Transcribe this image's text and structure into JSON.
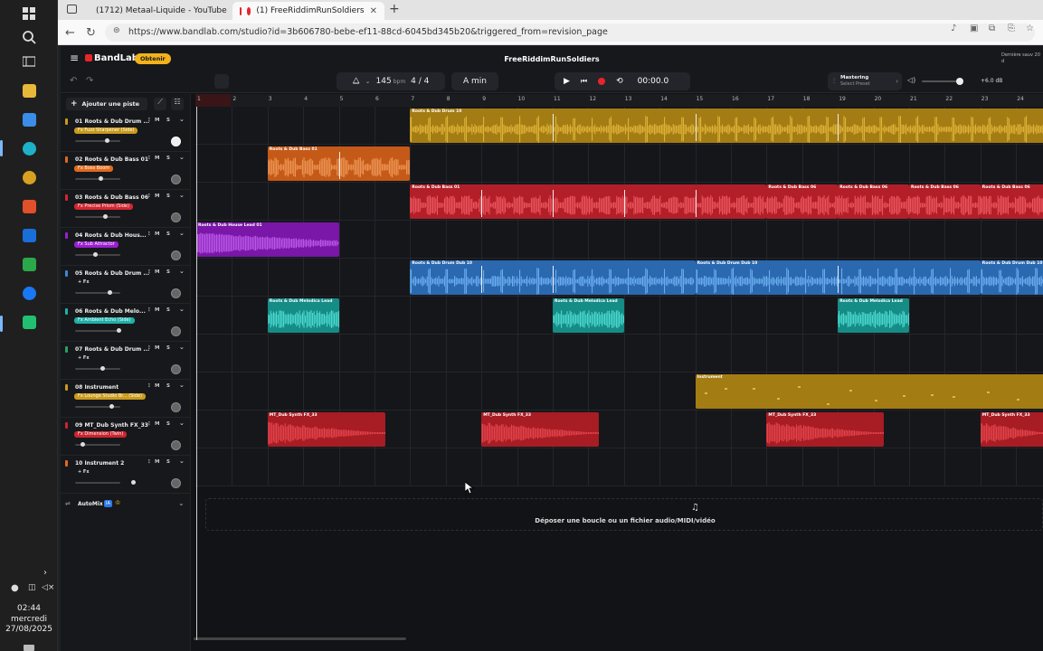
{
  "taskbar": {
    "time": "02:44",
    "day": "mercredi",
    "date": "27/08/2025"
  },
  "browser": {
    "tabs": [
      {
        "title": "(1712) Metaal-Liquide - YouTube"
      },
      {
        "title": "(1) FreeRiddimRunSoldiers"
      }
    ],
    "url": "https://www.bandlab.com/studio?id=3b606780-bebe-ef11-88cd-6045bd345b20&triggered_from=revision_page"
  },
  "app": {
    "logo": "BandLab",
    "upgrade": "Obtenir",
    "project_title": "FreeRiddimRunSoldiers",
    "last_saved": "Dernière sauv 20 d",
    "tempo": "145",
    "tempo_unit": "bpm",
    "time_sig": "4 / 4",
    "key": "A min",
    "time": "00:00.0",
    "mastering": "Mastering",
    "preset": "Select Preset",
    "master_db": "+6.0 dB",
    "add_track": "Ajouter une piste",
    "ruler": [
      "1",
      "2",
      "3",
      "4",
      "5",
      "6",
      "7",
      "8",
      "9",
      "10",
      "11",
      "12",
      "13",
      "14",
      "15",
      "16",
      "17",
      "18",
      "19",
      "20",
      "21",
      "22",
      "23",
      "24"
    ],
    "automix": "AutoMix",
    "automix_badge": "IA",
    "drop_text": "Déposer une boucle ou un fichier audio/MIDI/vidéo",
    "tracks": [
      {
        "name": "01 Roots & Dub Drum ...",
        "fx": "Fx Fuzz Sharpener (Side)",
        "color": "#c99a1c",
        "fxcolor": "#c99a1c"
      },
      {
        "name": "02 Roots & Dub Bass 01",
        "fx": "Fx Boss Boom",
        "color": "#e06a1f",
        "fxcolor": "#e06a1f"
      },
      {
        "name": "03 Roots & Dub Bass 06",
        "fx": "Fx Precise Prism (Side)",
        "color": "#d02730",
        "fxcolor": "#d02730"
      },
      {
        "name": "04 Roots & Dub Hous...",
        "fx": "Fx Sub Attractor",
        "color": "#9a1fd0",
        "fxcolor": "#9a1fd0"
      },
      {
        "name": "05 Roots & Dub Drum ...",
        "fx": "+ Fx",
        "color": "#3c86d8",
        "fxcolor": ""
      },
      {
        "name": "06 Roots & Dub Melo...",
        "fx": "Fx Ambient Echo (Side)",
        "color": "#1fb0a8",
        "fxcolor": "#1fb0a8"
      },
      {
        "name": "07 Roots & Dub Drum ...",
        "fx": "+ Fx",
        "color": "#2aa060",
        "fxcolor": ""
      },
      {
        "name": "08 Instrument",
        "fx": "Fx Lounge Studio Br... (Side)",
        "color": "#c99a1c",
        "fxcolor": "#c99a1c"
      },
      {
        "name": "09 MT_Dub Synth FX_33",
        "fx": "Fx Dimension (Twin)",
        "color": "#c9252e",
        "fxcolor": "#c9252e"
      },
      {
        "name": "10 Instrument 2",
        "fx": "+ Fx",
        "color": "#e06a1f",
        "fxcolor": ""
      }
    ],
    "clips": [
      {
        "lane": 0,
        "start": 7,
        "end": 25,
        "label": "Roots & Dub Drum 10",
        "color": "#a47c14",
        "wave": "#e2b83a",
        "type": "drum"
      },
      {
        "lane": 1,
        "start": 3,
        "end": 7,
        "label": "Roots & Dub Bass 01",
        "color": "#c55a18",
        "wave": "#f09a5a",
        "type": "bass"
      },
      {
        "lane": 2,
        "start": 7,
        "end": 17,
        "label": "Roots & Dub Bass 01",
        "color": "#b21f28",
        "wave": "#f05a62",
        "type": "bass"
      },
      {
        "lane": 2,
        "start": 17,
        "end": 19,
        "label": "Roots & Dub Bass 06",
        "color": "#b21f28",
        "wave": "#f05a62",
        "type": "bass"
      },
      {
        "lane": 2,
        "start": 19,
        "end": 21,
        "label": "Roots & Dub Bass 06",
        "color": "#b21f28",
        "wave": "#f05a62",
        "type": "bass"
      },
      {
        "lane": 2,
        "start": 21,
        "end": 23,
        "label": "Roots & Dub Bass 06",
        "color": "#b21f28",
        "wave": "#f05a62",
        "type": "bass"
      },
      {
        "lane": 2,
        "start": 23,
        "end": 25,
        "label": "Roots & Dub Bass 06",
        "color": "#b21f28",
        "wave": "#f05a62",
        "type": "bass"
      },
      {
        "lane": 3,
        "start": 1,
        "end": 5,
        "label": "Roots & Dub House Lead 01",
        "color": "#7a16a8",
        "wave": "#c05ef0",
        "type": "lead"
      },
      {
        "lane": 4,
        "start": 7,
        "end": 15,
        "label": "Roots & Dub Drum Dub 10",
        "color": "#2a68b0",
        "wave": "#70b4f4",
        "type": "drum"
      },
      {
        "lane": 4,
        "start": 15,
        "end": 23,
        "label": "Roots & Dub Drum Dub 10",
        "color": "#2a68b0",
        "wave": "#70b4f4",
        "type": "drum"
      },
      {
        "lane": 4,
        "start": 23,
        "end": 25,
        "label": "Roots & Dub Drum Dub 10",
        "color": "#2a68b0",
        "wave": "#70b4f4",
        "type": "drum"
      },
      {
        "lane": 5,
        "start": 3,
        "end": 5,
        "label": "Roots & Dub Melodica Lead",
        "color": "#168c86",
        "wave": "#50e0d6",
        "type": "mel"
      },
      {
        "lane": 5,
        "start": 11,
        "end": 13,
        "label": "Roots & Dub Melodica Lead",
        "color": "#168c86",
        "wave": "#50e0d6",
        "type": "mel"
      },
      {
        "lane": 5,
        "start": 19,
        "end": 21,
        "label": "Roots & Dub Melodica Lead",
        "color": "#168c86",
        "wave": "#50e0d6",
        "type": "mel"
      },
      {
        "lane": 7,
        "start": 15,
        "end": 25,
        "label": "Instrument",
        "color": "#a47c14",
        "wave": "#e2b83a",
        "type": "midi"
      },
      {
        "lane": 8,
        "start": 3,
        "end": 6.3,
        "label": "MT_Dub Synth FX_33",
        "color": "#a81c24",
        "wave": "#e8484f",
        "type": "fx"
      },
      {
        "lane": 8,
        "start": 9,
        "end": 12.3,
        "label": "MT_Dub Synth FX_33",
        "color": "#a81c24",
        "wave": "#e8484f",
        "type": "fx"
      },
      {
        "lane": 8,
        "start": 17,
        "end": 20.3,
        "label": "MT_Dub Synth FX_33",
        "color": "#a81c24",
        "wave": "#e8484f",
        "type": "fx"
      },
      {
        "lane": 8,
        "start": 23,
        "end": 26.3,
        "label": "MT_Dub Synth FX_33",
        "color": "#a81c24",
        "wave": "#e8484f",
        "type": "fx"
      }
    ]
  }
}
